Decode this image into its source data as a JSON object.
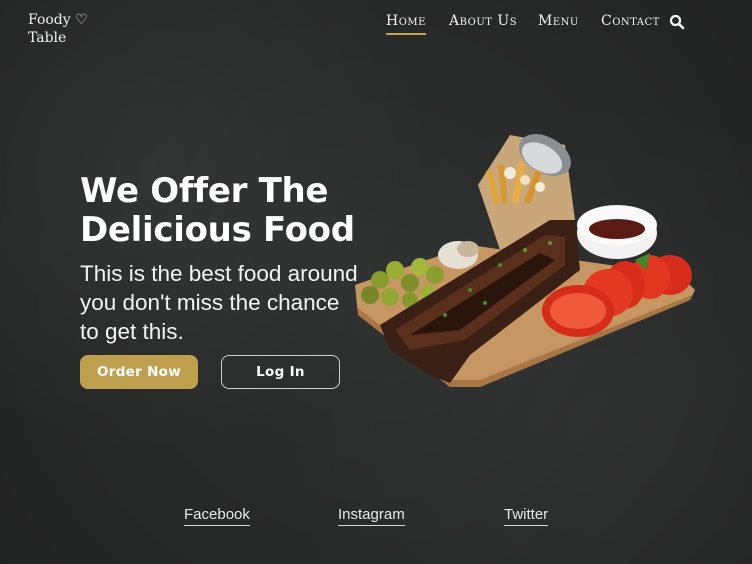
{
  "logo": {
    "line1": "Foody ♡",
    "line2": "Table"
  },
  "nav": {
    "items": [
      {
        "label": "Home",
        "active": true
      },
      {
        "label": "About Us",
        "active": false
      },
      {
        "label": "Menu",
        "active": false
      },
      {
        "label": "Contact",
        "active": false
      }
    ],
    "search_icon": "search-icon"
  },
  "hero": {
    "title": "We Offer The Delicious Food",
    "subtitle": "This is the best food around you don't miss the chance to get this.",
    "primary_button": "Order Now",
    "secondary_button": "Log In"
  },
  "social": [
    "Facebook",
    "Instagram",
    "Twitter"
  ],
  "colors": {
    "accent": "#bfa04e",
    "background": "#2e2f2f",
    "text": "#ffffff"
  }
}
